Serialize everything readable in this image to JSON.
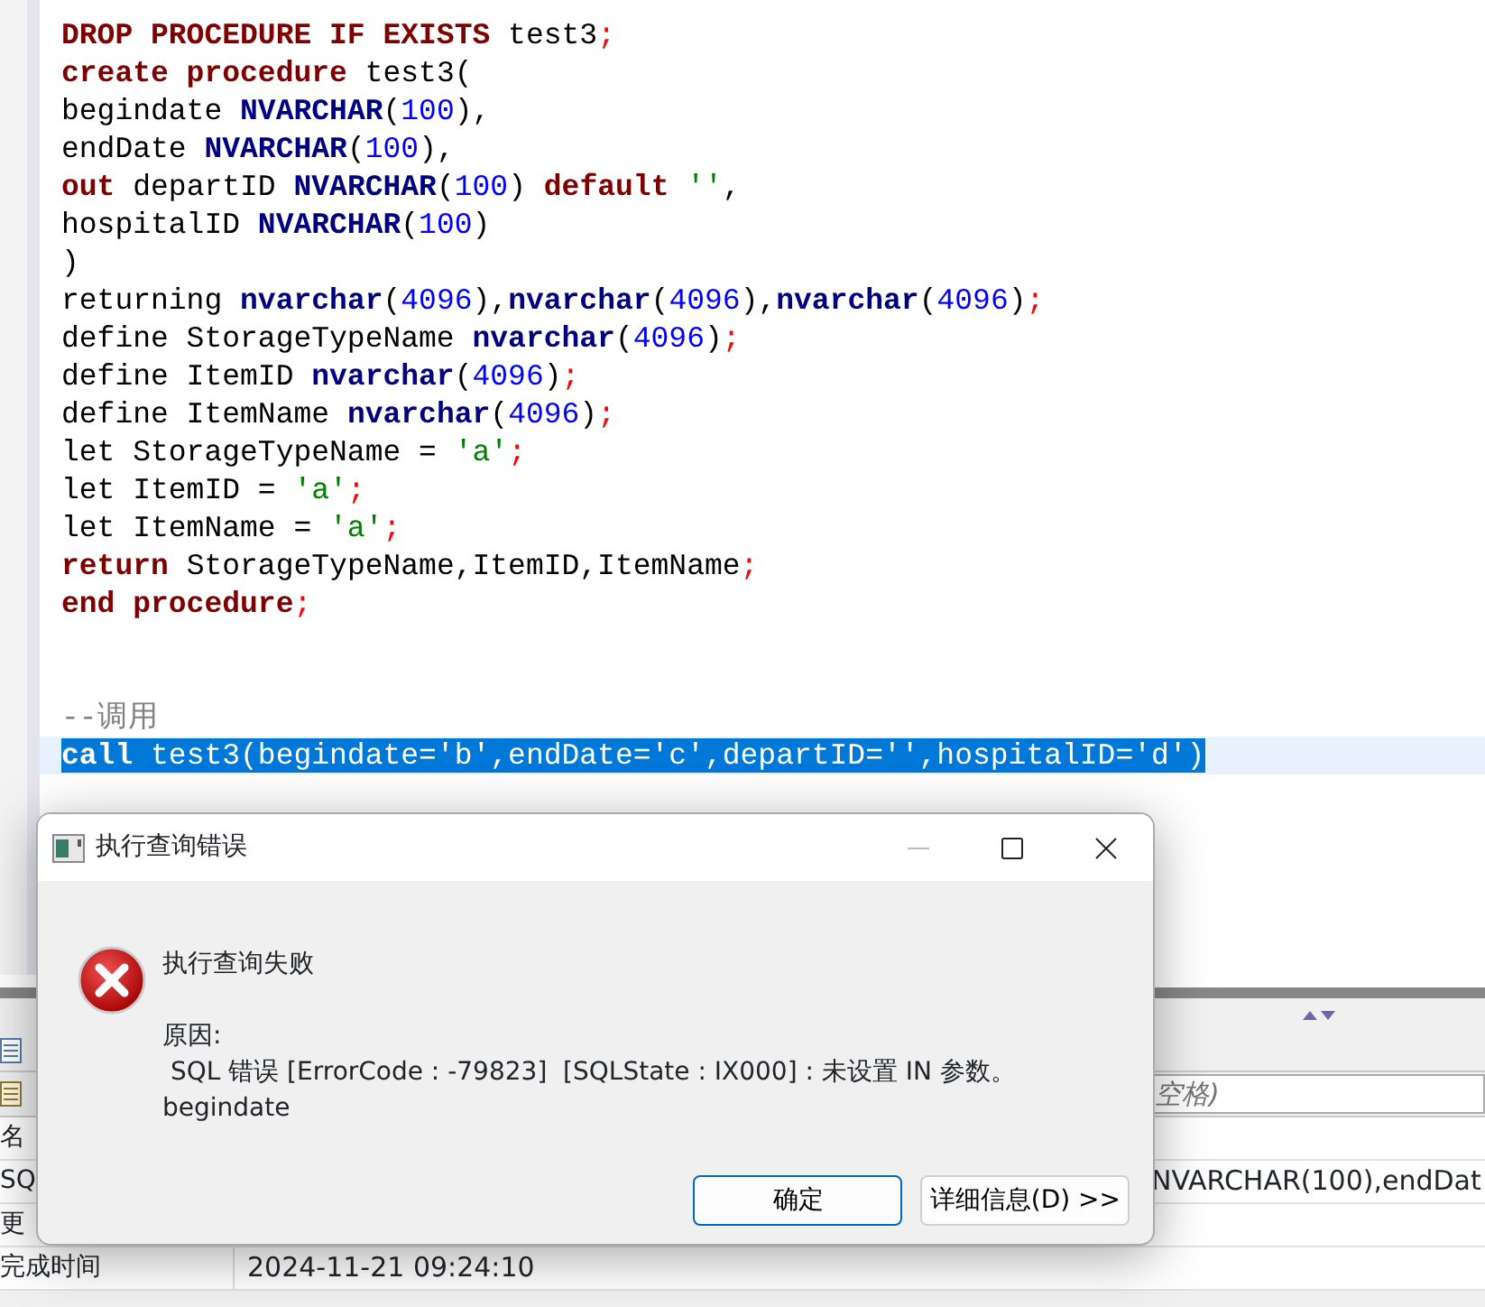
{
  "editor": {
    "lines": [
      {
        "kind": "code",
        "selected": false,
        "tokens": [
          {
            "kind": "keyword",
            "text": "DROP PROCEDURE IF EXISTS"
          },
          {
            "kind": "plain",
            "text": " test3"
          },
          {
            "kind": "punct",
            "text": ";"
          }
        ]
      },
      {
        "kind": "code",
        "selected": false,
        "tokens": [
          {
            "kind": "keyword",
            "text": "create procedure"
          },
          {
            "kind": "plain",
            "text": " test3("
          }
        ]
      },
      {
        "kind": "code",
        "selected": false,
        "tokens": [
          {
            "kind": "plain",
            "text": "begindate "
          },
          {
            "kind": "type",
            "text": "NVARCHAR"
          },
          {
            "kind": "plain",
            "text": "("
          },
          {
            "kind": "number",
            "text": "100"
          },
          {
            "kind": "plain",
            "text": "),"
          }
        ]
      },
      {
        "kind": "code",
        "selected": false,
        "tokens": [
          {
            "kind": "plain",
            "text": "endDate "
          },
          {
            "kind": "type",
            "text": "NVARCHAR"
          },
          {
            "kind": "plain",
            "text": "("
          },
          {
            "kind": "number",
            "text": "100"
          },
          {
            "kind": "plain",
            "text": "),"
          }
        ]
      },
      {
        "kind": "code",
        "selected": false,
        "tokens": [
          {
            "kind": "keyword",
            "text": "out"
          },
          {
            "kind": "plain",
            "text": " departID "
          },
          {
            "kind": "type",
            "text": "NVARCHAR"
          },
          {
            "kind": "plain",
            "text": "("
          },
          {
            "kind": "number",
            "text": "100"
          },
          {
            "kind": "plain",
            "text": ") "
          },
          {
            "kind": "keyword",
            "text": "default"
          },
          {
            "kind": "string",
            "text": " ''"
          },
          {
            "kind": "plain",
            "text": ","
          }
        ]
      },
      {
        "kind": "code",
        "selected": false,
        "tokens": [
          {
            "kind": "plain",
            "text": "hospitalID "
          },
          {
            "kind": "type",
            "text": "NVARCHAR"
          },
          {
            "kind": "plain",
            "text": "("
          },
          {
            "kind": "number",
            "text": "100"
          },
          {
            "kind": "plain",
            "text": ")"
          }
        ]
      },
      {
        "kind": "code",
        "selected": false,
        "tokens": [
          {
            "kind": "plain",
            "text": ")"
          }
        ]
      },
      {
        "kind": "code",
        "selected": false,
        "tokens": [
          {
            "kind": "plain",
            "text": "returning "
          },
          {
            "kind": "type",
            "text": "nvarchar"
          },
          {
            "kind": "plain",
            "text": "("
          },
          {
            "kind": "number",
            "text": "4096"
          },
          {
            "kind": "plain",
            "text": "),"
          },
          {
            "kind": "type",
            "text": "nvarchar"
          },
          {
            "kind": "plain",
            "text": "("
          },
          {
            "kind": "number",
            "text": "4096"
          },
          {
            "kind": "plain",
            "text": "),"
          },
          {
            "kind": "type",
            "text": "nvarchar"
          },
          {
            "kind": "plain",
            "text": "("
          },
          {
            "kind": "number",
            "text": "4096"
          },
          {
            "kind": "plain",
            "text": ")"
          },
          {
            "kind": "punct",
            "text": ";"
          }
        ]
      },
      {
        "kind": "code",
        "selected": false,
        "tokens": [
          {
            "kind": "plain",
            "text": "define StorageTypeName "
          },
          {
            "kind": "type",
            "text": "nvarchar"
          },
          {
            "kind": "plain",
            "text": "("
          },
          {
            "kind": "number",
            "text": "4096"
          },
          {
            "kind": "plain",
            "text": ")"
          },
          {
            "kind": "punct",
            "text": ";"
          }
        ]
      },
      {
        "kind": "code",
        "selected": false,
        "tokens": [
          {
            "kind": "plain",
            "text": "define ItemID "
          },
          {
            "kind": "type",
            "text": "nvarchar"
          },
          {
            "kind": "plain",
            "text": "("
          },
          {
            "kind": "number",
            "text": "4096"
          },
          {
            "kind": "plain",
            "text": ")"
          },
          {
            "kind": "punct",
            "text": ";"
          }
        ]
      },
      {
        "kind": "code",
        "selected": false,
        "tokens": [
          {
            "kind": "plain",
            "text": "define ItemName "
          },
          {
            "kind": "type",
            "text": "nvarchar"
          },
          {
            "kind": "plain",
            "text": "("
          },
          {
            "kind": "number",
            "text": "4096"
          },
          {
            "kind": "plain",
            "text": ")"
          },
          {
            "kind": "punct",
            "text": ";"
          }
        ]
      },
      {
        "kind": "code",
        "selected": false,
        "tokens": [
          {
            "kind": "plain",
            "text": "let StorageTypeName = "
          },
          {
            "kind": "string",
            "text": "'a'"
          },
          {
            "kind": "punct",
            "text": ";"
          }
        ]
      },
      {
        "kind": "code",
        "selected": false,
        "tokens": [
          {
            "kind": "plain",
            "text": "let ItemID = "
          },
          {
            "kind": "string",
            "text": "'a'"
          },
          {
            "kind": "punct",
            "text": ";"
          }
        ]
      },
      {
        "kind": "code",
        "selected": false,
        "tokens": [
          {
            "kind": "plain",
            "text": "let ItemName = "
          },
          {
            "kind": "string",
            "text": "'a'"
          },
          {
            "kind": "punct",
            "text": ";"
          }
        ]
      },
      {
        "kind": "code",
        "selected": false,
        "tokens": [
          {
            "kind": "keyword",
            "text": "return"
          },
          {
            "kind": "plain",
            "text": " StorageTypeName,ItemID,ItemName"
          },
          {
            "kind": "punct",
            "text": ";"
          }
        ]
      },
      {
        "kind": "code",
        "selected": false,
        "tokens": [
          {
            "kind": "keyword",
            "text": "end procedure"
          },
          {
            "kind": "punct",
            "text": ";"
          }
        ]
      },
      {
        "kind": "blank"
      },
      {
        "kind": "blank"
      },
      {
        "kind": "code",
        "selected": false,
        "tokens": [
          {
            "kind": "comment",
            "text": "--调用"
          }
        ]
      },
      {
        "kind": "code",
        "selected": true,
        "tokens": [
          {
            "kind": "keyword",
            "text": "call"
          },
          {
            "kind": "plain",
            "text": " test3(begindate='b',endDate='c',departID='',hospitalID='d')"
          }
        ]
      }
    ]
  },
  "bottom_panel": {
    "search": {
      "placeholder": "空格)"
    },
    "rows": [
      {
        "label": "名"
      },
      {
        "label": "SQ",
        "value": "NVARCHAR(100),endDat"
      },
      {
        "label": "更"
      },
      {
        "label": "完成时间",
        "value": "2024-11-21 09:24:10"
      }
    ]
  },
  "dialog": {
    "title": "执行查询错误",
    "heading": "执行查询失败",
    "reason_label": "原因:",
    "detail": " SQL 错误 [ErrorCode : -79823]  [SQLState : IX000] : 未设置 IN 参数。",
    "detail_2": "begindate",
    "buttons": [
      {
        "label": "确定",
        "default": true
      },
      {
        "label": "详细信息(D) >>",
        "default": false
      }
    ]
  }
}
